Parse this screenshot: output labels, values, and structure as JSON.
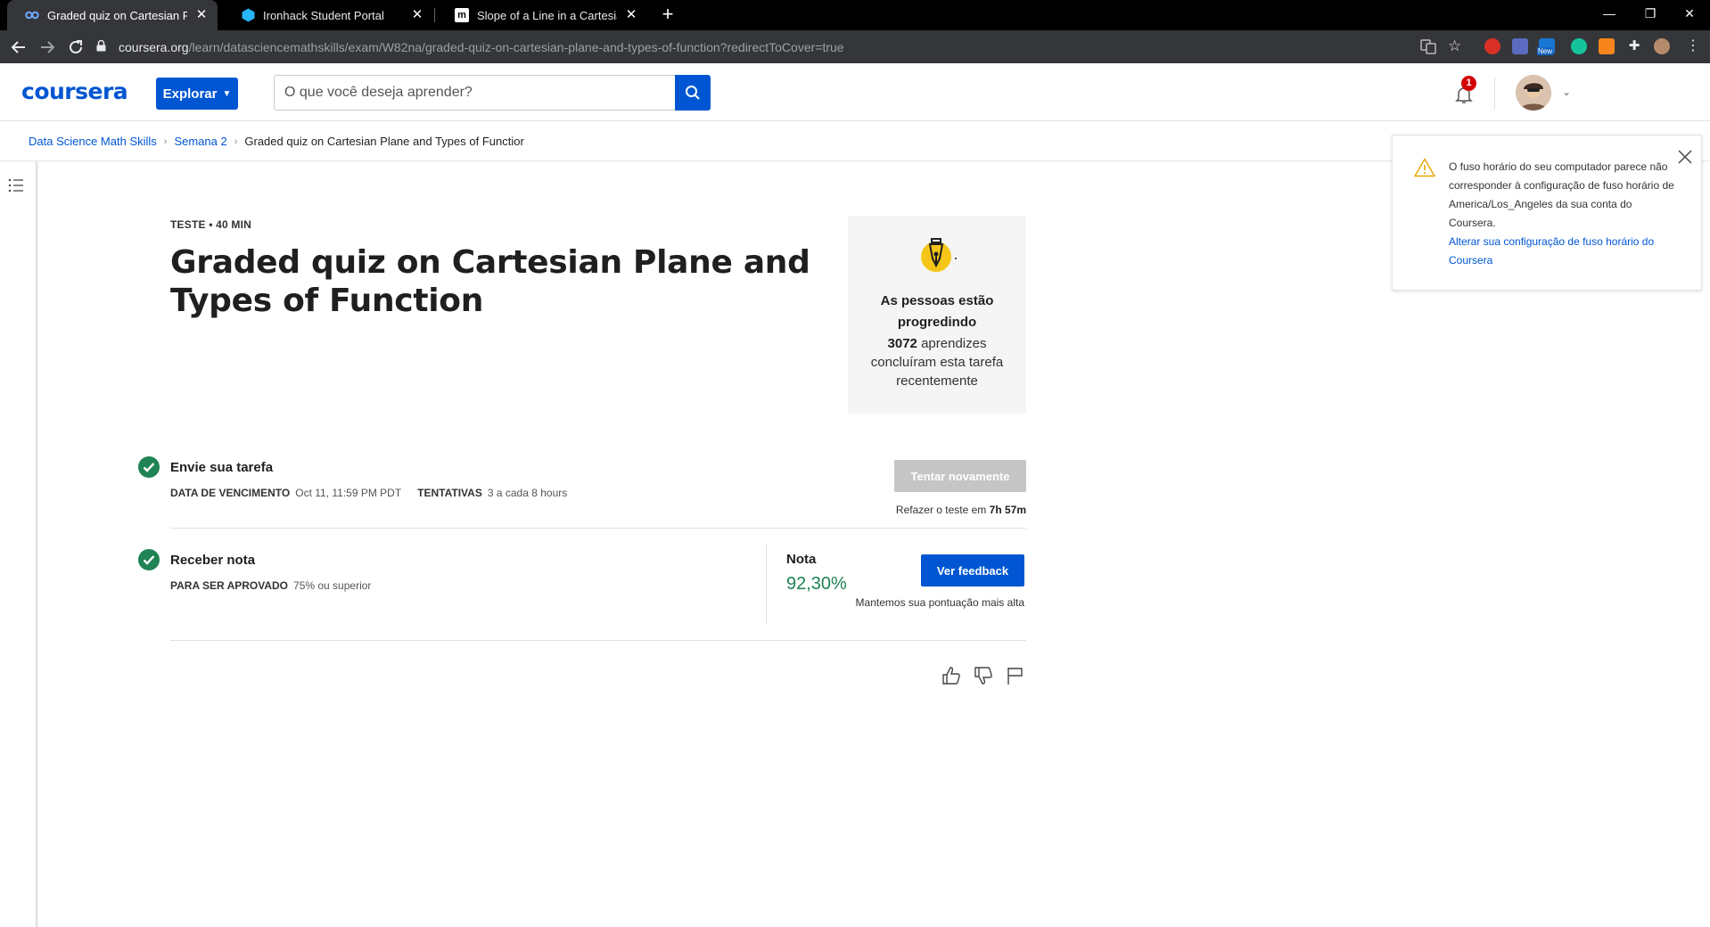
{
  "browser": {
    "tabs": [
      {
        "title": "Graded quiz on Cartesian Plane a",
        "active": true
      },
      {
        "title": "Ironhack Student Portal",
        "active": false
      },
      {
        "title": "Slope of a Line in a Cartesian Pla",
        "active": false
      }
    ],
    "url_host": "coursera.org",
    "url_path": "/learn/datasciencemathskills/exam/W82na/graded-quiz-on-cartesian-plane-and-types-of-function?redirectToCover=true",
    "extension_new_badge": "New"
  },
  "header": {
    "logo": "coursera",
    "explore_label": "Explorar",
    "search_placeholder": "O que você deseja aprender?",
    "notification_count": "1"
  },
  "breadcrumb": {
    "items": [
      "Data Science Math Skills",
      "Semana 2",
      "Graded quiz on Cartesian Plane and Types of Functior"
    ]
  },
  "quiz": {
    "kicker": "TESTE • 40 MIN",
    "title": "Graded quiz on Cartesian Plane and Types of Function"
  },
  "progress_card": {
    "heading": "As pessoas estão progredindo",
    "count": "3072",
    "text_after_count": " aprendizes concluíram esta tarefa recentemente"
  },
  "submit_step": {
    "title": "Envie sua tarefa",
    "due_label": "DATA DE VENCIMENTO",
    "due_value": "Oct 11, 11:59 PM PDT",
    "attempts_label": "TENTATIVAS",
    "attempts_value": "3 a cada 8 hours",
    "retry_button": "Tentar novamente",
    "retry_note_prefix": "Refazer o teste em ",
    "retry_note_time": "7h 57m"
  },
  "grade_step": {
    "title": "Receber nota",
    "pass_label": "PARA SER APROVADO",
    "pass_value": "75% ou superior",
    "grade_label": "Nota",
    "grade_value": "92,30%",
    "feedback_button": "Ver feedback",
    "grade_note": "Mantemos sua pontuação mais alta"
  },
  "toast": {
    "message": "O fuso horário do seu computador parece não corresponder à configuração de fuso horário de America/Los_Angeles da sua conta do Coursera.",
    "link": "Alterar sua configuração de fuso horário do Coursera"
  },
  "colors": {
    "brand": "#0056d2",
    "success": "#1f8354",
    "disabled_button": "#c5c5c5"
  }
}
